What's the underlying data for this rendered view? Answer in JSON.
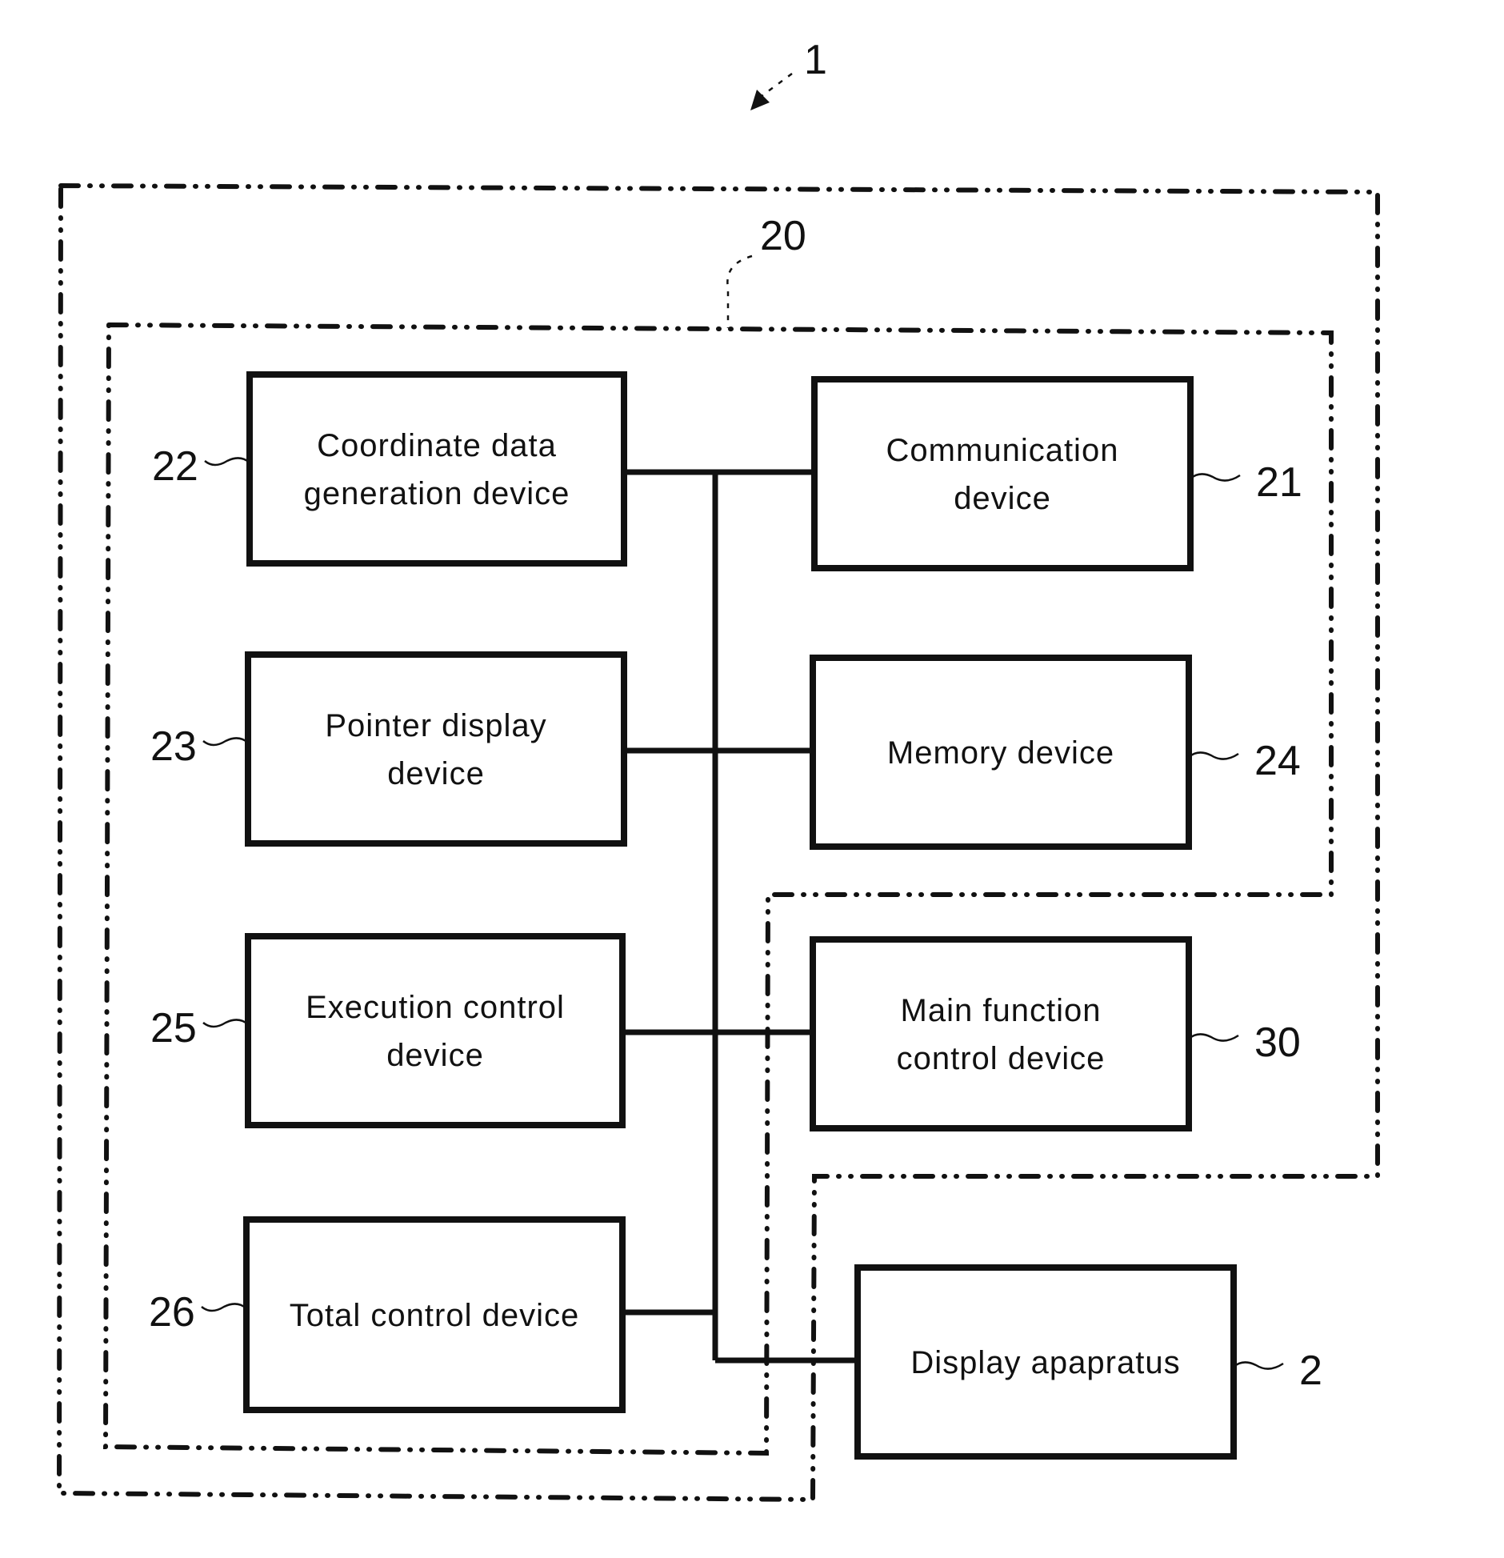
{
  "figure": {
    "system_ref": "1",
    "terminal_ref": "20"
  },
  "blocks": [
    {
      "id": "coordinate",
      "ref": "22",
      "lines": [
        "Coordinate data",
        "generation device"
      ]
    },
    {
      "id": "communication",
      "ref": "21",
      "lines": [
        "Communication",
        "device"
      ]
    },
    {
      "id": "pointer",
      "ref": "23",
      "lines": [
        "Pointer display",
        "device"
      ]
    },
    {
      "id": "memory",
      "ref": "24",
      "lines": [
        "Memory device"
      ]
    },
    {
      "id": "execution",
      "ref": "25",
      "lines": [
        "Execution control",
        "device"
      ]
    },
    {
      "id": "mainfunction",
      "ref": "30",
      "lines": [
        "Main function",
        "control device"
      ]
    },
    {
      "id": "total",
      "ref": "26",
      "lines": [
        "Total control device"
      ]
    },
    {
      "id": "display",
      "ref": "2",
      "lines": [
        "Display apapratus"
      ]
    }
  ]
}
